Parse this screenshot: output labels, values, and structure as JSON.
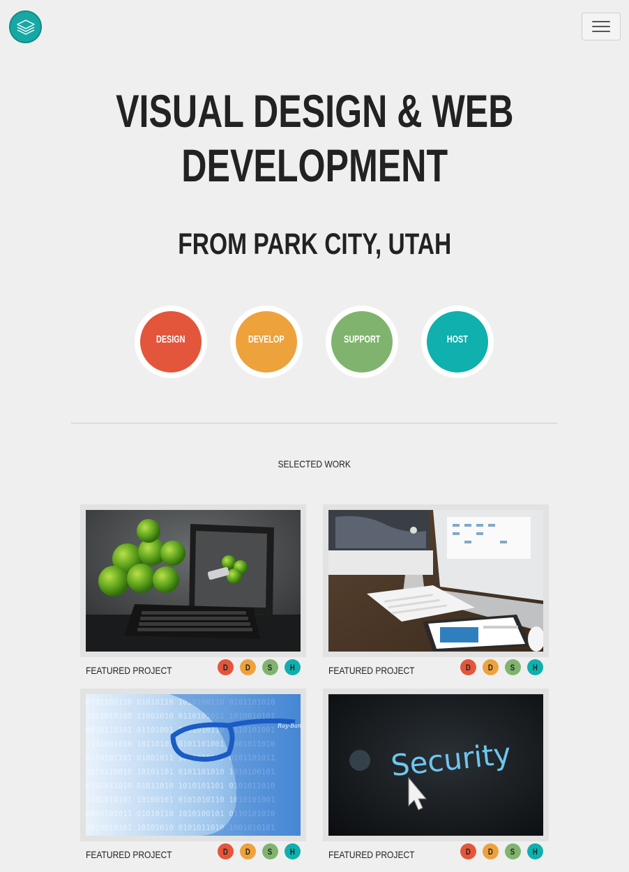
{
  "header": {
    "logo_icon": "layers-icon",
    "menu_icon": "hamburger-menu-icon"
  },
  "hero": {
    "title_line1": "VISUAL DESIGN & WEB",
    "title_line2": "DEVELOPMENT",
    "subtitle": "FROM PARK CITY, UTAH"
  },
  "services": [
    {
      "label": "DESIGN",
      "color": "#e4563b"
    },
    {
      "label": "DEVELOP",
      "color": "#eda23c"
    },
    {
      "label": "SUPPORT",
      "color": "#80b46e"
    },
    {
      "label": "HOST",
      "color": "#0fb0ad"
    }
  ],
  "work": {
    "section_label": "SELECTED WORK",
    "projects": [
      {
        "caption": "FEATURED PROJECT",
        "image": "tablet-with-green-apples",
        "badges": [
          "D",
          "D",
          "S",
          "H"
        ]
      },
      {
        "caption": "FEATURED PROJECT",
        "image": "imac-laptop-tablet-desk",
        "badges": [
          "D",
          "D",
          "S",
          "H"
        ]
      },
      {
        "caption": "FEATURED PROJECT",
        "image": "face-with-binary-code",
        "badges": [
          "D",
          "D",
          "S",
          "H"
        ]
      },
      {
        "caption": "FEATURED PROJECT",
        "image": "security-screen-cursor",
        "badges": [
          "D",
          "D",
          "S",
          "H"
        ]
      }
    ]
  },
  "colors": {
    "accent": "#17a8a4",
    "background": "#efefef",
    "design": "#e4563b",
    "develop": "#eda23c",
    "support": "#80b46e",
    "host": "#0fb0ad"
  }
}
